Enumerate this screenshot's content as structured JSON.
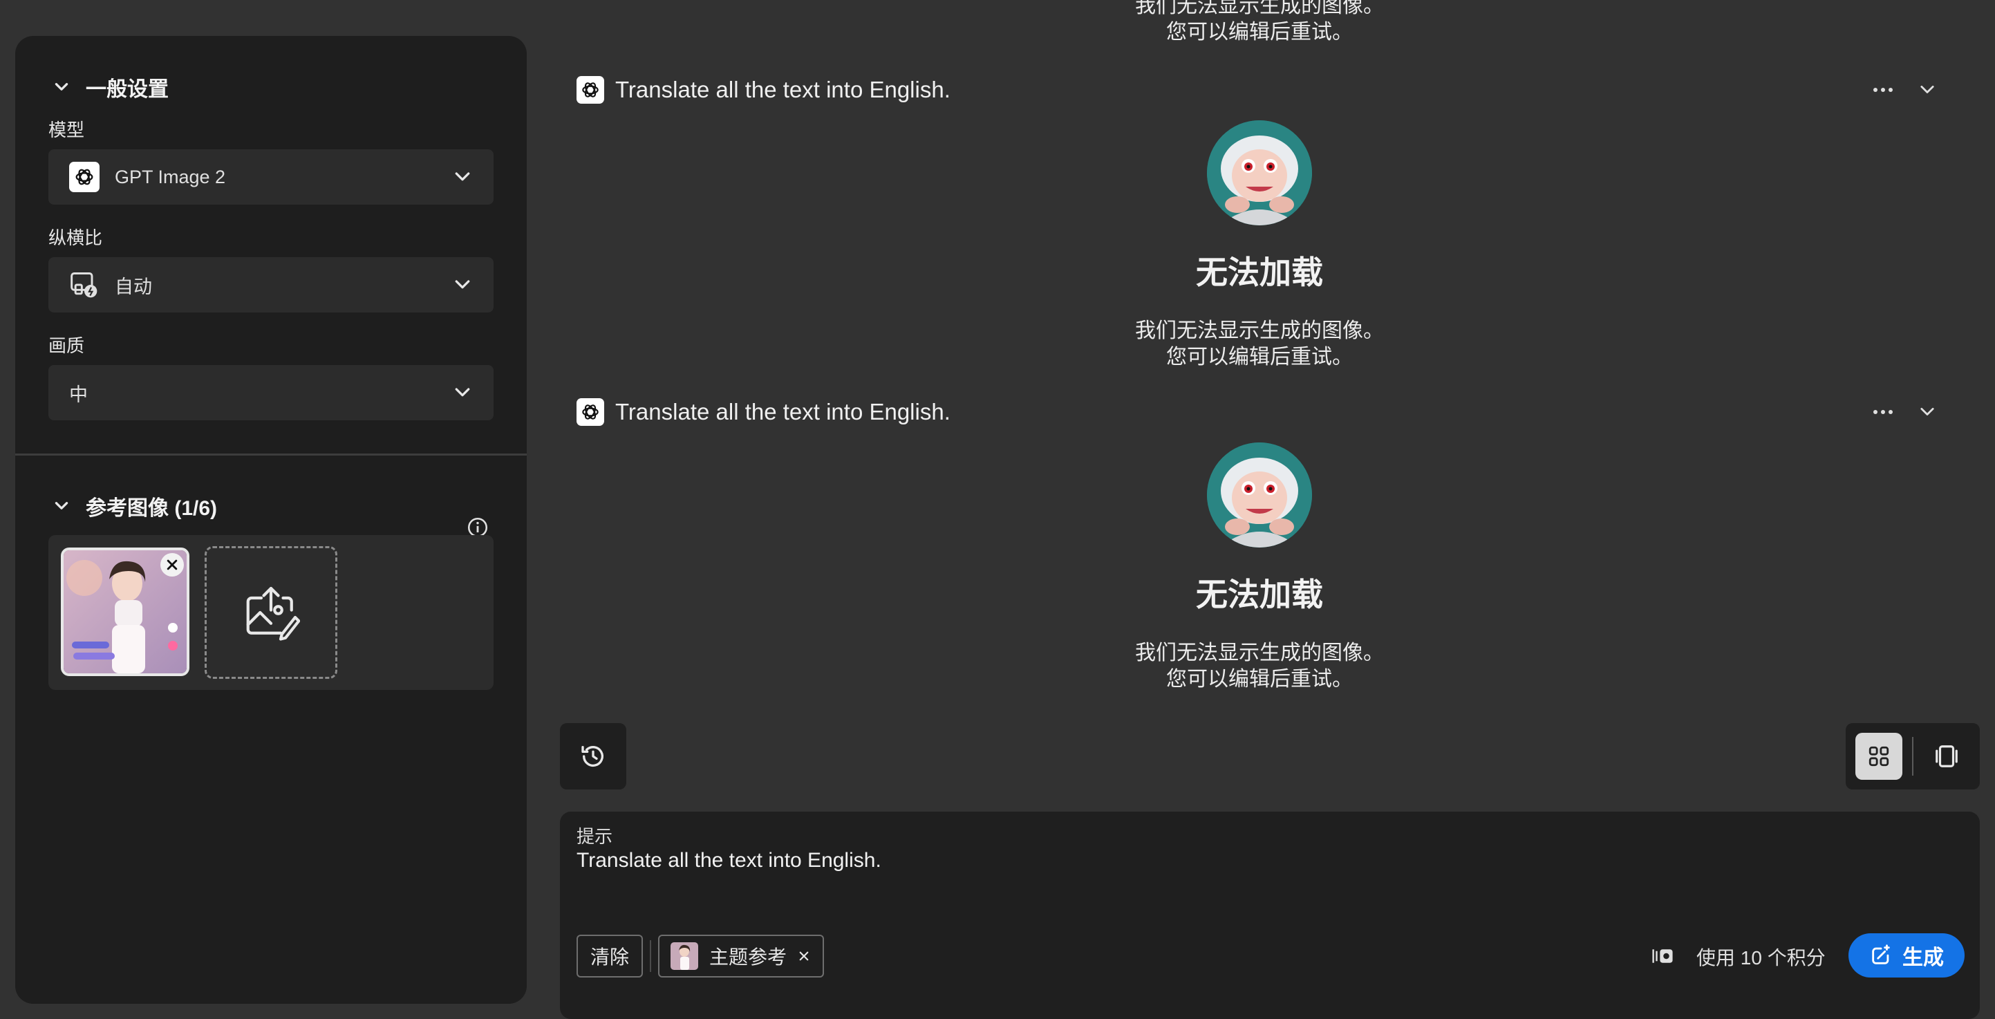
{
  "sidebar": {
    "general": {
      "title": "一般设置",
      "model_label": "模型",
      "model_value": "GPT Image 2",
      "aspect_label": "纵横比",
      "aspect_value": "自动",
      "quality_label": "画质",
      "quality_value": "中"
    },
    "reference": {
      "title": "参考图像 (1/6)"
    }
  },
  "feed": {
    "top_partial": {
      "line1": "我们无法显示生成的图像。",
      "line2": "您可以编辑后重试。"
    },
    "items": [
      {
        "prompt": "Translate all the text into English.",
        "error_title": "无法加载",
        "error_line1": "我们无法显示生成的图像。",
        "error_line2": "您可以编辑后重试。"
      },
      {
        "prompt": "Translate all the text into English.",
        "error_title": "无法加载",
        "error_line1": "我们无法显示生成的图像。",
        "error_line2": "您可以编辑后重试。"
      }
    ]
  },
  "prompt": {
    "label": "提示",
    "text": "Translate all the text into English.",
    "clear_label": "清除",
    "subject_ref_label": "主题参考",
    "credits_text": "使用 10 个积分",
    "generate_label": "生成"
  },
  "colors": {
    "accent": "#1473e6",
    "background": "#323232",
    "panel": "#1e1e1e",
    "field": "#2c2c2c"
  },
  "icons": [
    "chevron-down-icon",
    "openai-icon",
    "aspect-ratio-icon",
    "info-icon",
    "upload-image-icon",
    "close-icon",
    "more-icon",
    "history-icon",
    "grid-view-icon",
    "single-view-icon",
    "credits-icon",
    "generate-icon"
  ]
}
